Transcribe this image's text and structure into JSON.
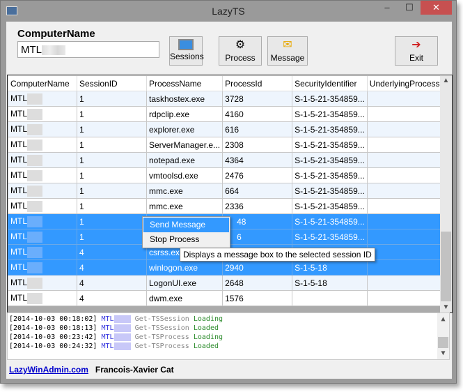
{
  "window": {
    "title": "LazyTS",
    "minimize": "–",
    "maximize": "☐",
    "close": "✕"
  },
  "computer": {
    "label": "ComputerName",
    "value": "MTL"
  },
  "toolbar": {
    "sessions": "Sessions",
    "process": "Process",
    "message": "Message",
    "exit": "Exit"
  },
  "grid": {
    "columns": [
      "ComputerName",
      "SessionID",
      "ProcessName",
      "ProcessId",
      "SecurityIdentifier",
      "UnderlyingProcess"
    ],
    "rows": [
      [
        "MTL",
        "1",
        "taskhostex.exe",
        "3728",
        "S-1-5-21-354859...",
        ""
      ],
      [
        "MTL",
        "1",
        "rdpclip.exe",
        "4160",
        "S-1-5-21-354859...",
        ""
      ],
      [
        "MTL",
        "1",
        "explorer.exe",
        "616",
        "S-1-5-21-354859...",
        ""
      ],
      [
        "MTL",
        "1",
        "ServerManager.e...",
        "2308",
        "S-1-5-21-354859...",
        ""
      ],
      [
        "MTL",
        "1",
        "notepad.exe",
        "4364",
        "S-1-5-21-354859...",
        ""
      ],
      [
        "MTL",
        "1",
        "vmtoolsd.exe",
        "2476",
        "S-1-5-21-354859...",
        ""
      ],
      [
        "MTL",
        "1",
        "mmc.exe",
        "664",
        "S-1-5-21-354859...",
        ""
      ],
      [
        "MTL",
        "1",
        "mmc.exe",
        "2336",
        "S-1-5-21-354859...",
        ""
      ],
      [
        "MTL",
        "1",
        "",
        "48",
        "S-1-5-21-354859...",
        ""
      ],
      [
        "MTL",
        "1",
        "",
        "6",
        "S-1-5-21-354859...",
        ""
      ],
      [
        "MTL",
        "4",
        "csrss.exe",
        "",
        "",
        ""
      ],
      [
        "MTL",
        "4",
        "winlogon.exe",
        "2940",
        "S-1-5-18",
        ""
      ],
      [
        "MTL",
        "4",
        "LogonUI.exe",
        "2648",
        "S-1-5-18",
        ""
      ],
      [
        "MTL",
        "4",
        "dwm.exe",
        "1576",
        "",
        ""
      ]
    ],
    "selected_rows": [
      8,
      9,
      10,
      11
    ]
  },
  "context_menu": {
    "items": [
      "Send Message",
      "Stop Process"
    ]
  },
  "tooltip": "Displays a message box to the selected session ID",
  "log": [
    {
      "time": "[2014-10-03 00:18:02]",
      "host": "MTL",
      "cmd": "Get-TSSession",
      "status": "Loading"
    },
    {
      "time": "[2014-10-03 00:18:13]",
      "host": "MTL",
      "cmd": "Get-TSSession",
      "status": "Loaded"
    },
    {
      "time": "[2014-10-03 00:23:42]",
      "host": "MTL",
      "cmd": "Get-TSProcess",
      "status": "Loading"
    },
    {
      "time": "[2014-10-03 00:24:32]",
      "host": "MTL",
      "cmd": "Get-TSProcess",
      "status": "Loaded"
    }
  ],
  "footer": {
    "link": "LazyWinAdmin.com",
    "author": "Francois-Xavier Cat"
  }
}
